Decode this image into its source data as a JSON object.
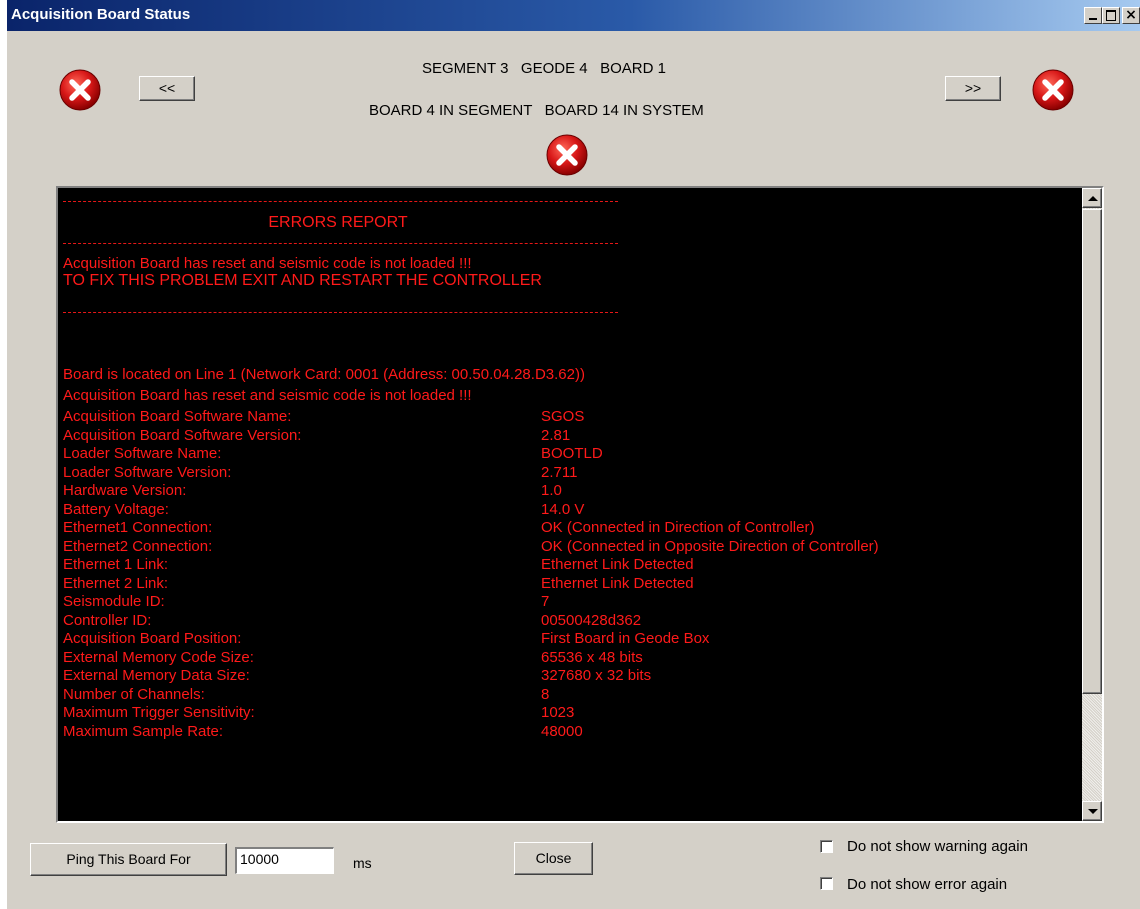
{
  "window": {
    "title": "Acquisition Board Status"
  },
  "header": {
    "line1": "SEGMENT 3   GEODE 4   BOARD 1",
    "line2": "BOARD 4 IN SEGMENT   BOARD 14 IN SYSTEM",
    "prev_label": "<<",
    "next_label": ">>"
  },
  "icons": {
    "status": "error-x-icon",
    "color": "#d81818"
  },
  "report": {
    "title": "ERRORS REPORT",
    "errors": [
      "Acquisition Board has reset and seismic code is not loaded !!!",
      "TO FIX THIS PROBLEM EXIT AND RESTART THE CONTROLLER"
    ],
    "location_line": "Board is located on Line 1 (Network Card: 0001  (Address: 00.50.04.28.D3.62))",
    "status_line": "Acquisition Board has reset and seismic code is not loaded !!!",
    "rows": [
      {
        "label": "Acquisition Board Software Name:",
        "value": "SGOS"
      },
      {
        "label": "Acquisition Board Software Version:",
        "value": "2.81"
      },
      {
        "label": "Loader Software Name:",
        "value": "BOOTLD"
      },
      {
        "label": "Loader Software Version:",
        "value": "2.711"
      },
      {
        "label": "Hardware Version:",
        "value": "1.0"
      },
      {
        "label": "Battery Voltage:",
        "value": "14.0 V"
      },
      {
        "label": "Ethernet1 Connection:",
        "value": "OK (Connected in Direction of Controller)"
      },
      {
        "label": "Ethernet2 Connection:",
        "value": "OK (Connected in Opposite Direction of Controller)"
      },
      {
        "label": "Ethernet 1 Link:",
        "value": "Ethernet Link Detected"
      },
      {
        "label": "Ethernet 2 Link:",
        "value": "Ethernet Link Detected"
      },
      {
        "label": "Seismodule ID:",
        "value": "7"
      },
      {
        "label": "Controller ID:",
        "value": "00500428d362"
      },
      {
        "label": "Acquisition Board Position:",
        "value": "First Board in Geode Box"
      },
      {
        "label": "External Memory Code Size:",
        "value": "65536 x 48 bits"
      },
      {
        "label": "External Memory Data Size:",
        "value": "327680 x 32 bits"
      },
      {
        "label": "Number of Channels:",
        "value": "8"
      },
      {
        "label": "Maximum Trigger Sensitivity:",
        "value": "1023"
      },
      {
        "label": "Maximum Sample Rate:",
        "value": "48000"
      }
    ]
  },
  "footer": {
    "ping_label": "Ping This Board  For",
    "ping_value": "10000",
    "ping_unit": "ms",
    "close_label": "Close",
    "warning_checkbox": "Do not show warning again",
    "error_checkbox": "Do not show error again"
  }
}
